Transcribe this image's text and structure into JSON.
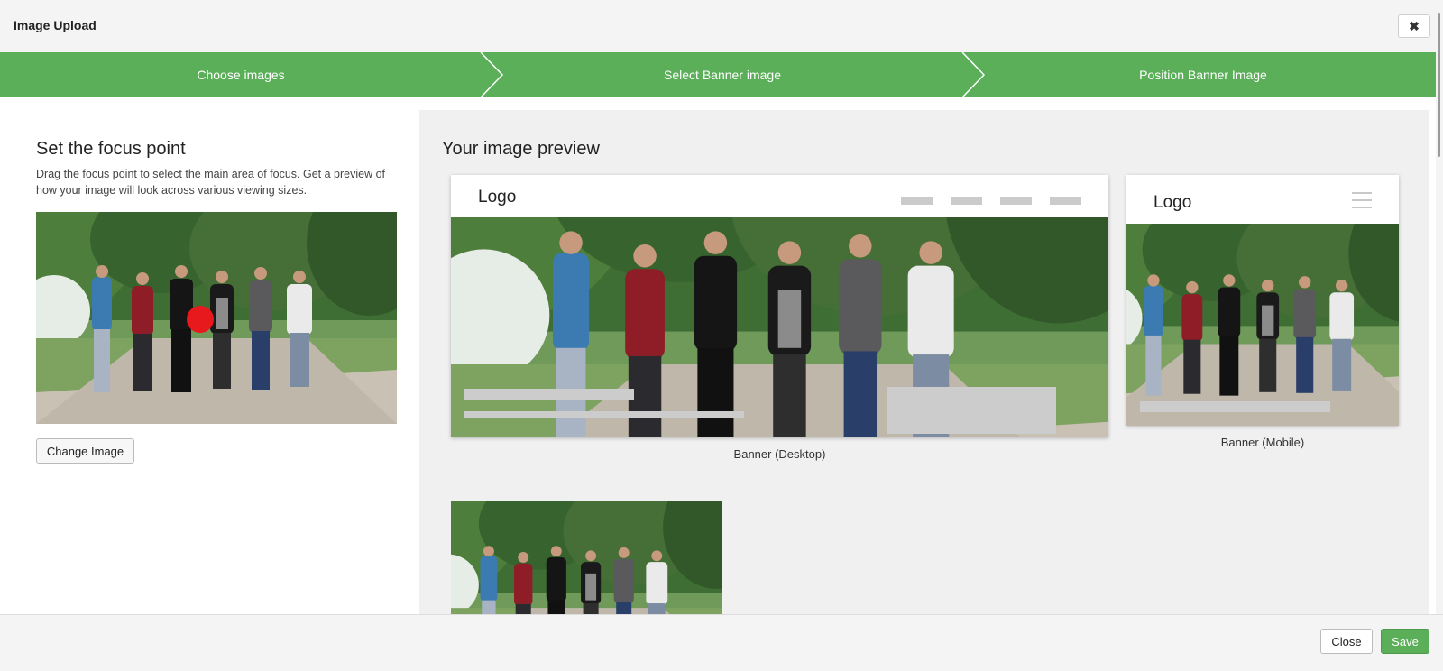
{
  "header": {
    "title": "Image Upload",
    "close_icon": "close-icon"
  },
  "steps": [
    {
      "label": "Choose images"
    },
    {
      "label": "Select Banner image"
    },
    {
      "label": "Position Banner Image"
    }
  ],
  "focus_panel": {
    "title": "Set the focus point",
    "description": "Drag the focus point to select the main area of focus. Get a preview of how your image will look across various viewing sizes.",
    "change_button": "Change Image"
  },
  "preview": {
    "title": "Your image preview",
    "desktop": {
      "logo": "Logo",
      "caption": "Banner (Desktop)"
    },
    "mobile": {
      "logo": "Logo",
      "caption": "Banner (Mobile)"
    }
  },
  "footer": {
    "close_label": "Close",
    "save_label": "Save"
  },
  "colors": {
    "accent": "#5aaf58",
    "focus_dot": "#e8191c",
    "placeholder": "#cccccc"
  }
}
